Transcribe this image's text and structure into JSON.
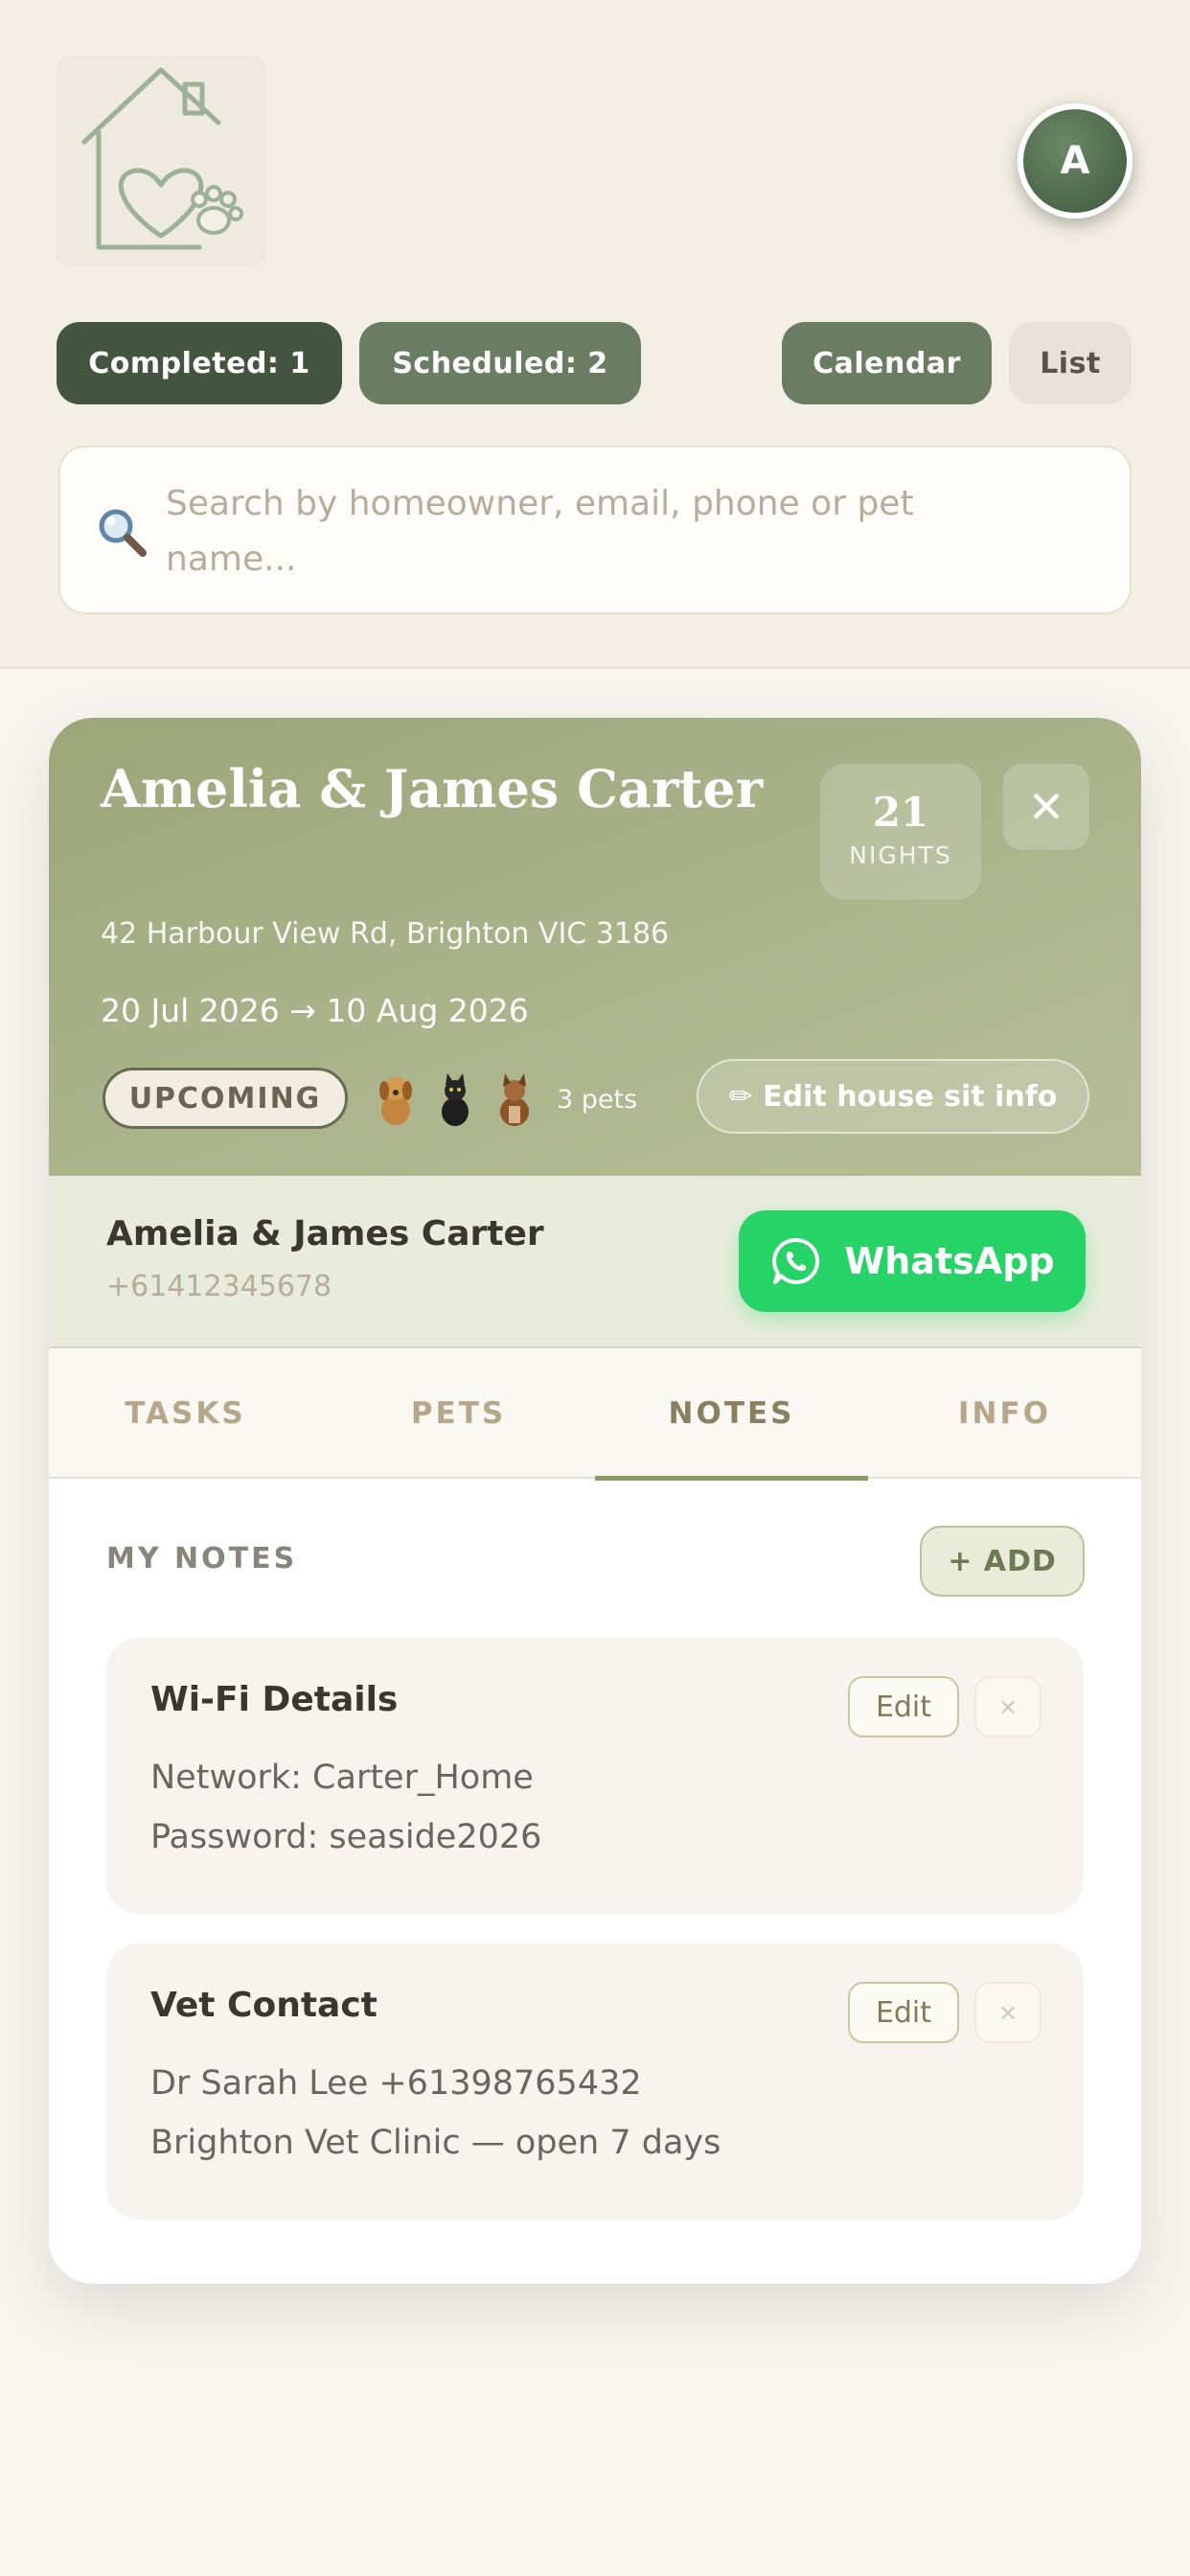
{
  "header": {
    "logo": "house-heart-paw-logo",
    "avatar_initial": "A"
  },
  "filters": {
    "completed_label": "Completed: 1",
    "scheduled_label": "Scheduled: 2",
    "calendar_label": "Calendar",
    "list_label": "List"
  },
  "search": {
    "icon": "search-icon",
    "placeholder": "Search by homeowner, email, phone or pet name..."
  },
  "sit": {
    "title": "Amelia & James Carter",
    "nights_value": "21",
    "nights_label": "NIGHTS",
    "close_glyph": "✕",
    "address": "42 Harbour View Rd, Brighton VIC 3186",
    "dates": "20 Jul 2026 → 10 Aug 2026",
    "status": "UPCOMING",
    "pet_icons": [
      "dog-icon",
      "cat-icon",
      "dog-icon"
    ],
    "pets_count": "3 pets",
    "edit_label": "✏ Edit house sit info"
  },
  "owner": {
    "name": "Amelia & James Carter",
    "phone": "+61412345678",
    "whatsapp_label": "WhatsApp"
  },
  "tabs": [
    {
      "label": "TASKS"
    },
    {
      "label": "PETS"
    },
    {
      "label": "NOTES"
    },
    {
      "label": "INFO"
    }
  ],
  "active_tab": "NOTES",
  "notes": {
    "heading": "MY NOTES",
    "add_label": "+ ADD",
    "items": [
      {
        "title": "Wi-Fi Details",
        "lines": [
          "Network: Carter_Home",
          "Password: seaside2026"
        ],
        "edit_label": "Edit",
        "delete_glyph": "×"
      },
      {
        "title": "Vet Contact",
        "lines": [
          "Dr Sarah Lee  +61398765432",
          "Brighton Vet Clinic — open 7 days"
        ],
        "edit_label": "Edit",
        "delete_glyph": "×"
      }
    ]
  },
  "colors": {
    "accent_dark": "#44553f",
    "accent": "#6a7d63",
    "hero": "#a3ac82",
    "whatsapp": "#25d366"
  }
}
